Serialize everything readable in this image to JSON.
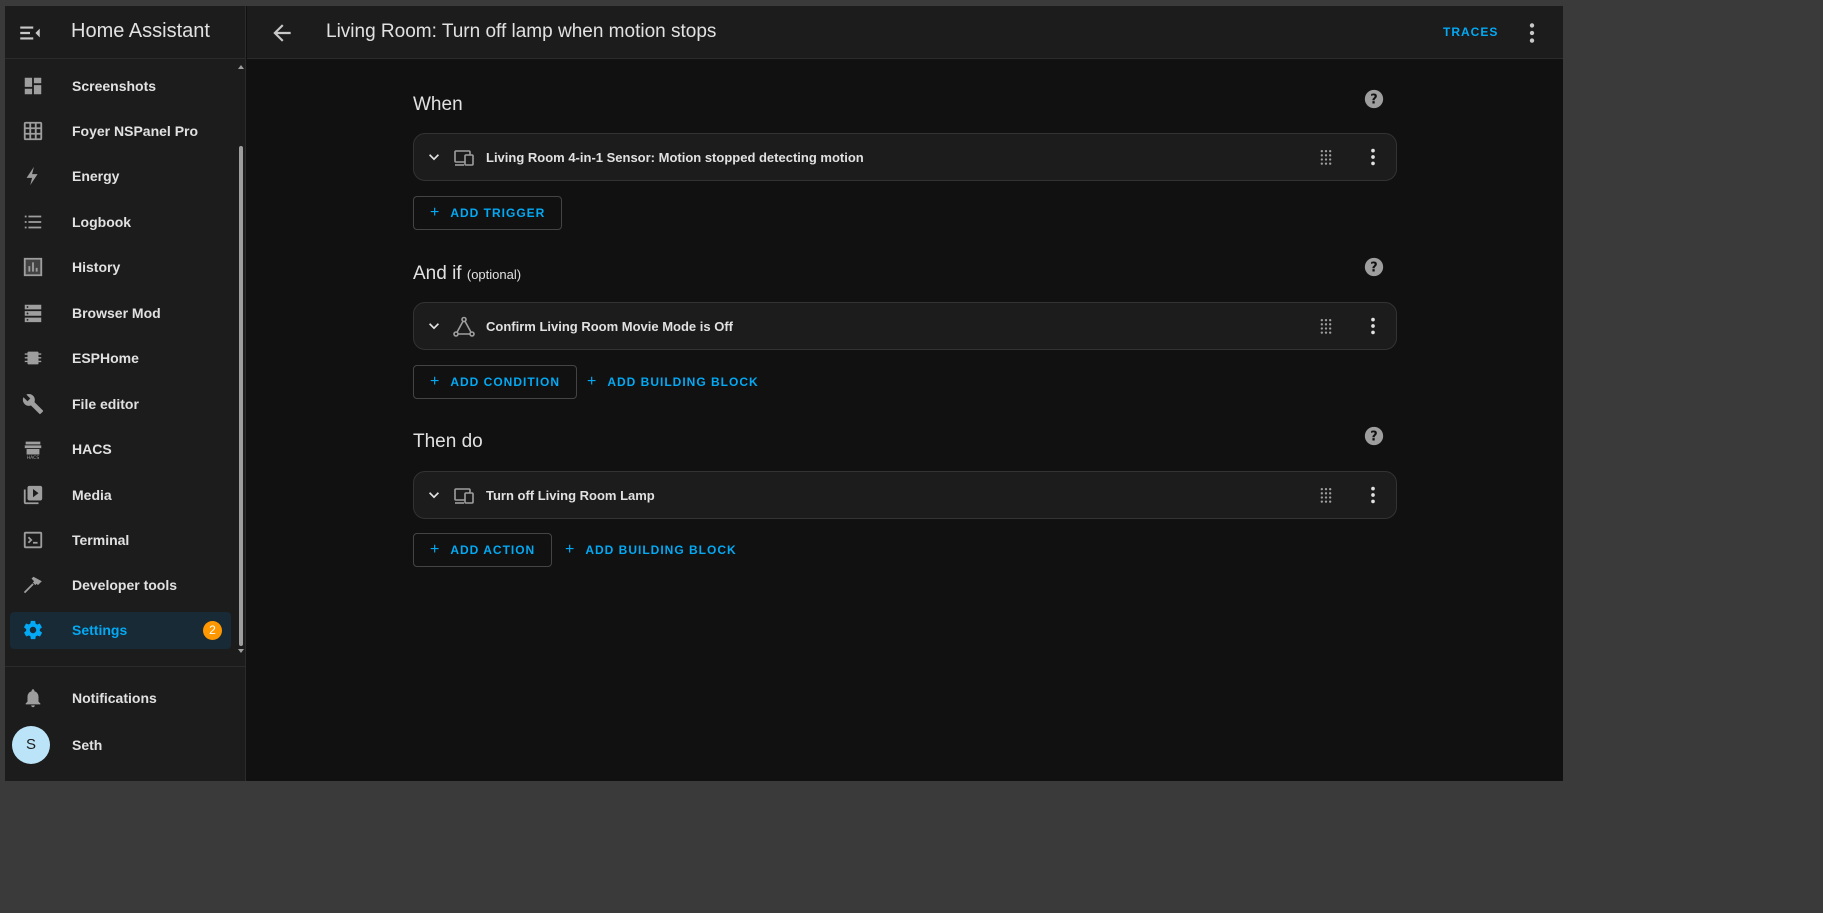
{
  "app": {
    "title": "Home Assistant"
  },
  "sidebar": {
    "items": [
      {
        "label": "Screenshots",
        "icon": "dashboard-icon"
      },
      {
        "label": "Foyer NSPanel Pro",
        "icon": "table-icon"
      },
      {
        "label": "Energy",
        "icon": "lightning-icon"
      },
      {
        "label": "Logbook",
        "icon": "list-icon"
      },
      {
        "label": "History",
        "icon": "chart-box-icon"
      },
      {
        "label": "Browser Mod",
        "icon": "server-icon"
      },
      {
        "label": "ESPHome",
        "icon": "chip-icon"
      },
      {
        "label": "File editor",
        "icon": "wrench-icon"
      },
      {
        "label": "HACS",
        "icon": "hacs-icon"
      },
      {
        "label": "Media",
        "icon": "play-box-icon"
      },
      {
        "label": "Terminal",
        "icon": "console-icon"
      },
      {
        "label": "Developer tools",
        "icon": "hammer-icon"
      },
      {
        "label": "Settings",
        "icon": "gear-icon",
        "badge": "2",
        "active": true
      }
    ],
    "notifications_label": "Notifications",
    "user": {
      "initial": "S",
      "name": "Seth"
    }
  },
  "header": {
    "title": "Living Room: Turn off lamp when motion stops",
    "traces_label": "TRACES"
  },
  "sections": {
    "when": {
      "title": "When",
      "card_text": "Living Room 4-in-1 Sensor: Motion stopped detecting motion",
      "add_label": "ADD TRIGGER"
    },
    "and_if": {
      "title": "And if",
      "optional": "(optional)",
      "card_text": "Confirm Living Room Movie Mode is Off",
      "add_label": "ADD CONDITION",
      "block_label": "ADD BUILDING BLOCK"
    },
    "then_do": {
      "title": "Then do",
      "card_text": "Turn off Living Room Lamp",
      "add_label": "ADD ACTION",
      "block_label": "ADD BUILDING BLOCK"
    }
  },
  "colors": {
    "accent": "#03a9f4",
    "badge": "#ff9800",
    "sidebar_bg": "#1c1c1c",
    "main_bg": "#111111"
  }
}
